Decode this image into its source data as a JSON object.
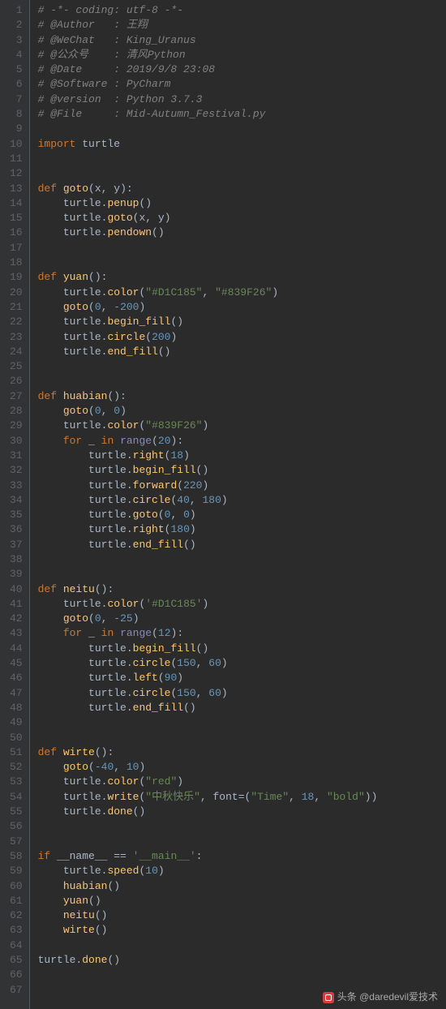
{
  "lineCount": 67,
  "watermark": "头条 @daredevil爱技术",
  "code": {
    "lines": [
      {
        "t": "comment",
        "text": "# -*- coding: utf-8 -*-"
      },
      {
        "t": "comment",
        "text": "# @Author   : 王翔"
      },
      {
        "t": "comment",
        "text": "# @WeChat   : King_Uranus"
      },
      {
        "t": "comment",
        "text": "# @公众号    : 清风Python"
      },
      {
        "t": "comment",
        "text": "# @Date     : 2019/9/8 23:08"
      },
      {
        "t": "comment",
        "text": "# @Software : PyCharm"
      },
      {
        "t": "comment",
        "text": "# @version  : Python 3.7.3"
      },
      {
        "t": "comment",
        "text": "# @File     : Mid-Autumn_Festival.py"
      },
      {
        "t": "blank"
      },
      {
        "t": "import",
        "kw": "import",
        "mod": "turtle"
      },
      {
        "t": "blank"
      },
      {
        "t": "blank"
      },
      {
        "t": "def",
        "name": "goto",
        "params": "x, y"
      },
      {
        "t": "call",
        "indent": 1,
        "obj": "turtle",
        "method": "penup",
        "args": []
      },
      {
        "t": "call",
        "indent": 1,
        "obj": "turtle",
        "method": "goto",
        "args": [
          {
            "k": "id",
            "v": "x"
          },
          {
            "k": "id",
            "v": "y"
          }
        ]
      },
      {
        "t": "call",
        "indent": 1,
        "obj": "turtle",
        "method": "pendown",
        "args": []
      },
      {
        "t": "blank"
      },
      {
        "t": "blank"
      },
      {
        "t": "def",
        "name": "yuan",
        "params": ""
      },
      {
        "t": "call",
        "indent": 1,
        "obj": "turtle",
        "method": "color",
        "args": [
          {
            "k": "str",
            "v": "\"#D1C185\""
          },
          {
            "k": "str",
            "v": "\"#839F26\""
          }
        ]
      },
      {
        "t": "call",
        "indent": 1,
        "obj": "",
        "method": "goto",
        "args": [
          {
            "k": "num",
            "v": "0"
          },
          {
            "k": "num",
            "v": "-200"
          }
        ]
      },
      {
        "t": "call",
        "indent": 1,
        "obj": "turtle",
        "method": "begin_fill",
        "args": []
      },
      {
        "t": "call",
        "indent": 1,
        "obj": "turtle",
        "method": "circle",
        "args": [
          {
            "k": "num",
            "v": "200"
          }
        ]
      },
      {
        "t": "call",
        "indent": 1,
        "obj": "turtle",
        "method": "end_fill",
        "args": []
      },
      {
        "t": "blank"
      },
      {
        "t": "blank"
      },
      {
        "t": "def",
        "name": "huabian",
        "params": ""
      },
      {
        "t": "call",
        "indent": 1,
        "obj": "",
        "method": "goto",
        "args": [
          {
            "k": "num",
            "v": "0"
          },
          {
            "k": "num",
            "v": "0"
          }
        ]
      },
      {
        "t": "call",
        "indent": 1,
        "obj": "turtle",
        "method": "color",
        "args": [
          {
            "k": "str",
            "v": "\"#839F26\""
          }
        ]
      },
      {
        "t": "for",
        "indent": 1,
        "var": "_",
        "iter": "range",
        "iterArg": "20"
      },
      {
        "t": "call",
        "indent": 2,
        "obj": "turtle",
        "method": "right",
        "args": [
          {
            "k": "num",
            "v": "18"
          }
        ]
      },
      {
        "t": "call",
        "indent": 2,
        "obj": "turtle",
        "method": "begin_fill",
        "args": []
      },
      {
        "t": "call",
        "indent": 2,
        "obj": "turtle",
        "method": "forward",
        "args": [
          {
            "k": "num",
            "v": "220"
          }
        ]
      },
      {
        "t": "call",
        "indent": 2,
        "obj": "turtle",
        "method": "circle",
        "args": [
          {
            "k": "num",
            "v": "40"
          },
          {
            "k": "num",
            "v": "180"
          }
        ]
      },
      {
        "t": "call",
        "indent": 2,
        "obj": "turtle",
        "method": "goto",
        "args": [
          {
            "k": "num",
            "v": "0"
          },
          {
            "k": "num",
            "v": "0"
          }
        ]
      },
      {
        "t": "call",
        "indent": 2,
        "obj": "turtle",
        "method": "right",
        "args": [
          {
            "k": "num",
            "v": "180"
          }
        ]
      },
      {
        "t": "call",
        "indent": 2,
        "obj": "turtle",
        "method": "end_fill",
        "args": []
      },
      {
        "t": "blank"
      },
      {
        "t": "blank"
      },
      {
        "t": "def",
        "name": "neitu",
        "params": ""
      },
      {
        "t": "call",
        "indent": 1,
        "obj": "turtle",
        "method": "color",
        "args": [
          {
            "k": "str",
            "v": "'#D1C185'"
          }
        ]
      },
      {
        "t": "call",
        "indent": 1,
        "obj": "",
        "method": "goto",
        "args": [
          {
            "k": "num",
            "v": "0"
          },
          {
            "k": "num",
            "v": "-25"
          }
        ]
      },
      {
        "t": "for",
        "indent": 1,
        "var": "_",
        "iter": "range",
        "iterArg": "12"
      },
      {
        "t": "call",
        "indent": 2,
        "obj": "turtle",
        "method": "begin_fill",
        "args": []
      },
      {
        "t": "call",
        "indent": 2,
        "obj": "turtle",
        "method": "circle",
        "args": [
          {
            "k": "num",
            "v": "150"
          },
          {
            "k": "num",
            "v": "60"
          }
        ]
      },
      {
        "t": "call",
        "indent": 2,
        "obj": "turtle",
        "method": "left",
        "args": [
          {
            "k": "num",
            "v": "90"
          }
        ]
      },
      {
        "t": "call",
        "indent": 2,
        "obj": "turtle",
        "method": "circle",
        "args": [
          {
            "k": "num",
            "v": "150"
          },
          {
            "k": "num",
            "v": "60"
          }
        ]
      },
      {
        "t": "call",
        "indent": 2,
        "obj": "turtle",
        "method": "end_fill",
        "args": []
      },
      {
        "t": "blank"
      },
      {
        "t": "blank"
      },
      {
        "t": "def",
        "name": "wirte",
        "params": ""
      },
      {
        "t": "call",
        "indent": 1,
        "obj": "",
        "method": "goto",
        "args": [
          {
            "k": "num",
            "v": "-40"
          },
          {
            "k": "num",
            "v": "10"
          }
        ]
      },
      {
        "t": "call",
        "indent": 1,
        "obj": "turtle",
        "method": "color",
        "args": [
          {
            "k": "str",
            "v": "\"red\""
          }
        ]
      },
      {
        "t": "write",
        "indent": 1
      },
      {
        "t": "call",
        "indent": 1,
        "obj": "turtle",
        "method": "done",
        "args": []
      },
      {
        "t": "blank"
      },
      {
        "t": "blank"
      },
      {
        "t": "ifmain"
      },
      {
        "t": "call",
        "indent": 1,
        "obj": "turtle",
        "method": "speed",
        "args": [
          {
            "k": "num",
            "v": "10"
          }
        ]
      },
      {
        "t": "call",
        "indent": 1,
        "obj": "",
        "method": "huabian",
        "args": []
      },
      {
        "t": "call",
        "indent": 1,
        "obj": "",
        "method": "yuan",
        "args": []
      },
      {
        "t": "call",
        "indent": 1,
        "obj": "",
        "method": "neitu",
        "args": []
      },
      {
        "t": "call",
        "indent": 1,
        "obj": "",
        "method": "wirte",
        "args": []
      },
      {
        "t": "blank"
      },
      {
        "t": "call",
        "indent": 0,
        "obj": "turtle",
        "method": "done",
        "args": []
      },
      {
        "t": "blank"
      },
      {
        "t": "blank"
      }
    ],
    "writeLine": {
      "text": "\"中秋快乐\"",
      "fontKw": "font",
      "fontArgs": [
        "\"Time\"",
        "18",
        "\"bold\""
      ]
    },
    "ifmain": {
      "kw1": "if",
      "name": "__name__",
      "op": "==",
      "val": "'__main__'"
    }
  }
}
